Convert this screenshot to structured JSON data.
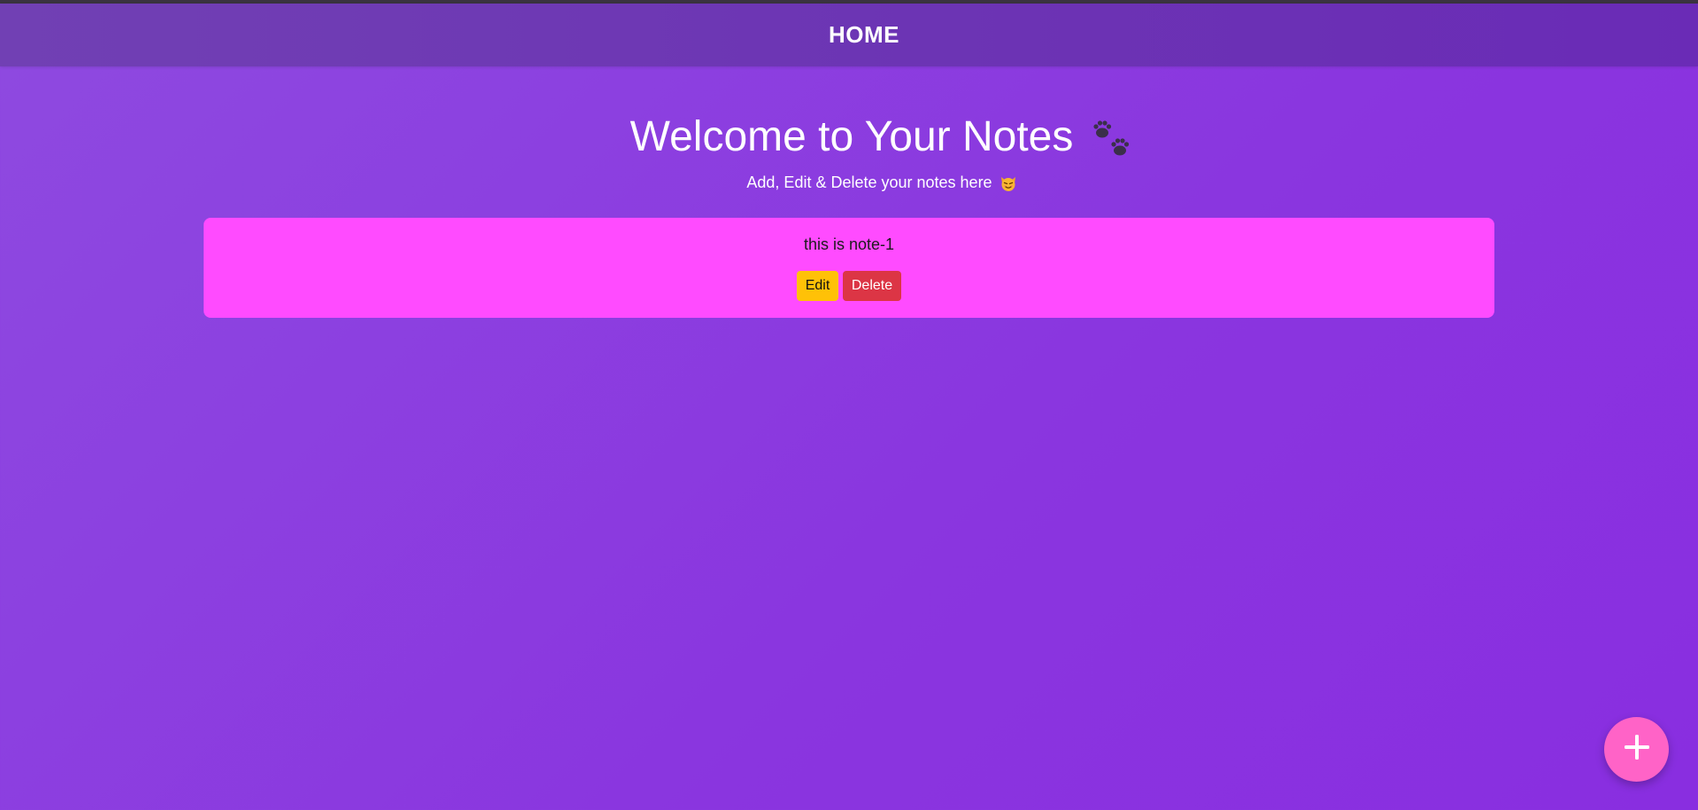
{
  "nav": {
    "title": "HOME"
  },
  "hero": {
    "title": "Welcome to Your Notes",
    "title_icon": "paw-prints-icon",
    "subtitle": "Add, Edit & Delete your notes here",
    "subtitle_icon": "cat-face-icon"
  },
  "notes": [
    {
      "text": "this is note-1",
      "edit_label": "Edit",
      "delete_label": "Delete"
    }
  ],
  "fab": {
    "icon": "plus-icon"
  },
  "colors": {
    "navbar": "#6c34b4",
    "background": "#8a35df",
    "note_card": "#ff4bff",
    "edit_button": "#ffc107",
    "delete_button": "#dc3545",
    "fab": "#ff63c7"
  }
}
